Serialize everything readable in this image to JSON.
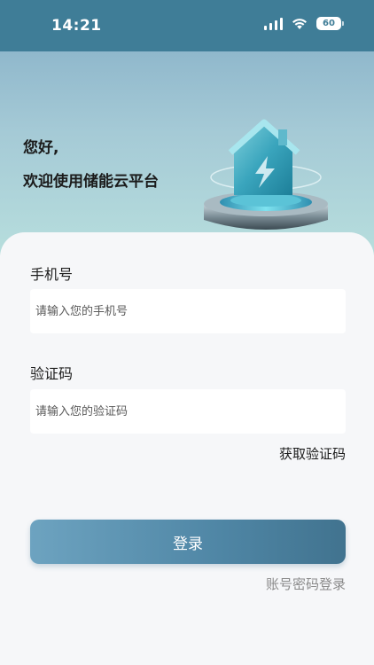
{
  "status_bar": {
    "time": "14:21",
    "battery": "60"
  },
  "hero": {
    "greeting": "您好,",
    "welcome": "欢迎使用储能云平台"
  },
  "form": {
    "phone_label": "手机号",
    "phone_placeholder": "请输入您的手机号",
    "code_label": "验证码",
    "code_placeholder": "请输入您的验证码",
    "get_code": "获取验证码",
    "login_button": "登录",
    "password_login": "账号密码登录"
  },
  "colors": {
    "status_bar_bg": "#3f7d97",
    "accent": "#4f86a5"
  },
  "icons": {
    "signal": "cellular-signal-icon",
    "wifi": "wifi-icon",
    "battery": "battery-icon",
    "illustration": "energy-storage-house-icon"
  }
}
